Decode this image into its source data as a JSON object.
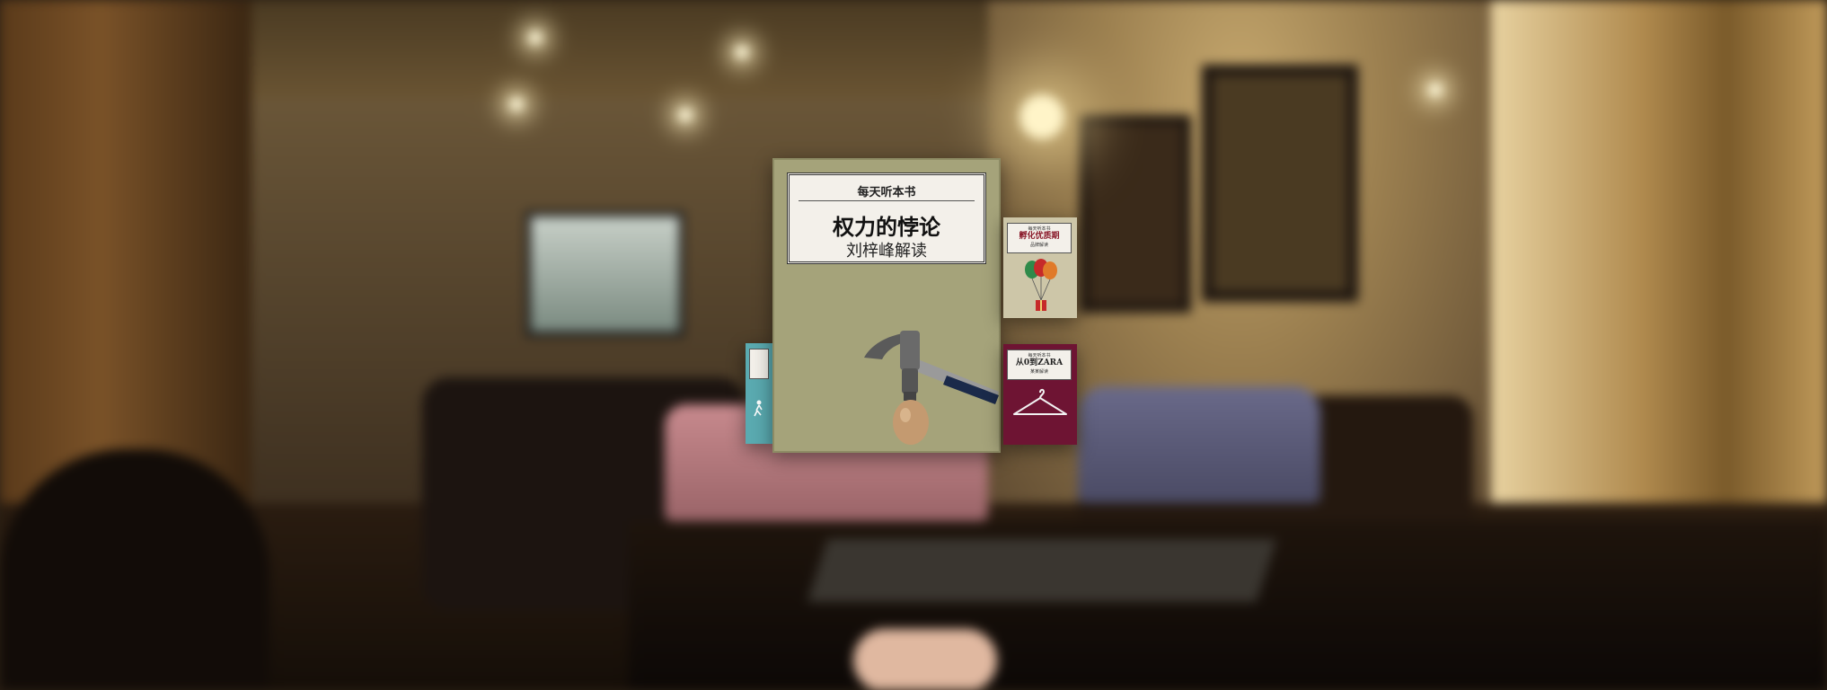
{
  "screen": {
    "description_free": true
  },
  "carousel": {
    "featured_book": {
      "series_label": "每天听本书",
      "title": "权力的悖论",
      "author_line": "刘梓峰解读",
      "cover_color": "#a5a37a",
      "cover_icon": "hammer-egg-icon"
    },
    "side_books": [
      {
        "position": "right-top",
        "series_label": "每天听本书",
        "title": "孵化优质期",
        "author_line": "品牌解读",
        "cover_color": "#cdc6a8",
        "cover_icon": "balloons-icon"
      },
      {
        "position": "right-bottom",
        "series_label": "每天听本书",
        "title": "从0到ZARA",
        "author_line": "某某解读",
        "cover_color": "#6e1433",
        "cover_icon": "hanger-icon"
      },
      {
        "position": "left",
        "cover_color": "#5aaab0",
        "cover_icon": "figure-icon"
      }
    ]
  }
}
